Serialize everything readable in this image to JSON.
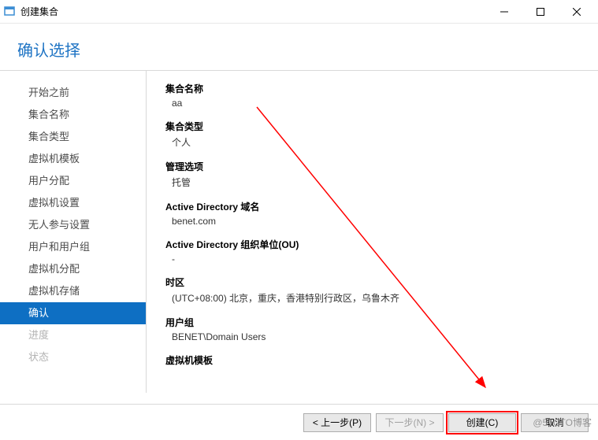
{
  "window": {
    "title": "创建集合"
  },
  "heading": "确认选择",
  "sidebar": {
    "items": [
      {
        "label": "开始之前"
      },
      {
        "label": "集合名称"
      },
      {
        "label": "集合类型"
      },
      {
        "label": "虚拟机模板"
      },
      {
        "label": "用户分配"
      },
      {
        "label": "虚拟机设置"
      },
      {
        "label": "无人参与设置"
      },
      {
        "label": "用户和用户组"
      },
      {
        "label": "虚拟机分配"
      },
      {
        "label": "虚拟机存储"
      },
      {
        "label": "确认",
        "active": true
      },
      {
        "label": "进度",
        "disabled": true
      },
      {
        "label": "状态",
        "disabled": true
      }
    ]
  },
  "fields": [
    {
      "label": "集合名称",
      "value": "aa"
    },
    {
      "label": "集合类型",
      "value": "个人"
    },
    {
      "label": "管理选项",
      "value": "托管"
    },
    {
      "label": "Active Directory 域名",
      "value": "benet.com"
    },
    {
      "label": "Active Directory 组织单位(OU)",
      "value": "-"
    },
    {
      "label": "时区",
      "value": "(UTC+08:00) 北京，重庆，香港特别行政区，乌鲁木齐"
    },
    {
      "label": "用户组",
      "value": "BENET\\Domain Users"
    },
    {
      "label": "虚拟机模板",
      "value": ""
    }
  ],
  "footer": {
    "prev": "< 上一步(P)",
    "next": "下一步(N) >",
    "create": "创建(C)",
    "cancel": "取消"
  },
  "watermark": "@51CTO博客"
}
